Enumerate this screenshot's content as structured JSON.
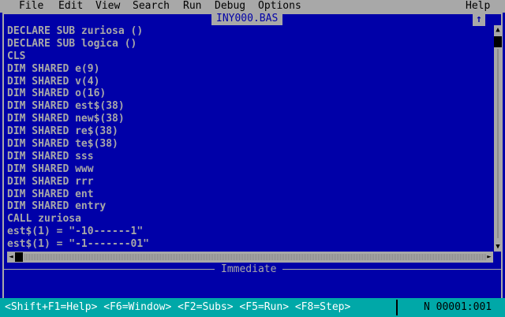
{
  "menu": {
    "items": [
      {
        "label": "File"
      },
      {
        "label": "Edit"
      },
      {
        "label": "View"
      },
      {
        "label": "Search"
      },
      {
        "label": "Run"
      },
      {
        "label": "Debug"
      },
      {
        "label": "Options"
      }
    ],
    "help": "Help"
  },
  "editor": {
    "title": "INY000.BAS",
    "maximize_glyph": "↑",
    "lines": [
      "DECLARE SUB zuriosa ()",
      "DECLARE SUB logica ()",
      "CLS",
      "DIM SHARED e(9)",
      "DIM SHARED v(4)",
      "DIM SHARED o(16)",
      "DIM SHARED est$(38)",
      "DIM SHARED new$(38)",
      "DIM SHARED re$(38)",
      "DIM SHARED te$(38)",
      "DIM SHARED sss",
      "DIM SHARED www",
      "DIM SHARED rrr",
      "DIM SHARED ent",
      "DIM SHARED entry",
      "CALL zuriosa",
      "est$(1) = \"-10------1\"",
      "est$(1) = \"-1-------01\""
    ]
  },
  "immediate": {
    "title": "Immediate"
  },
  "statusbar": {
    "hints": "<Shift+F1=Help> <F6=Window> <F2=Subs> <F5=Run> <F8=Step>",
    "position": "N 00001:001"
  },
  "colors": {
    "background": "#0000A8",
    "menu": "#A8A8A8",
    "status": "#00A8A8",
    "text": "#A8A8A8"
  }
}
